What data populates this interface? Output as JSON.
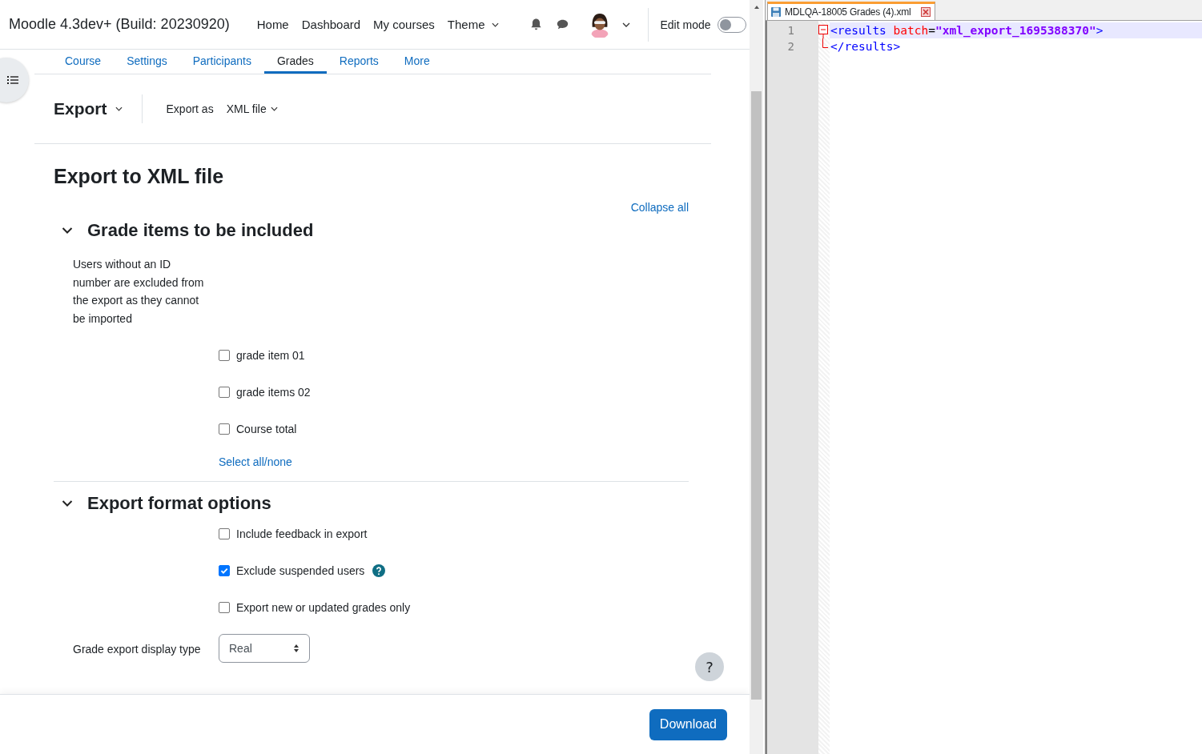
{
  "browser": {
    "site_name": "Moodle 4.3dev+ (Build: 20230920)",
    "nav_links": [
      {
        "label": "Home",
        "dropdown": false
      },
      {
        "label": "Dashboard",
        "dropdown": false
      },
      {
        "label": "My courses",
        "dropdown": false
      },
      {
        "label": "Theme",
        "dropdown": true
      }
    ],
    "edit_mode": {
      "label": "Edit mode",
      "on": false
    },
    "secondary_nav": [
      {
        "label": "Course",
        "selected": false
      },
      {
        "label": "Settings",
        "selected": false
      },
      {
        "label": "Participants",
        "selected": false
      },
      {
        "label": "Grades",
        "selected": true
      },
      {
        "label": "Reports",
        "selected": false
      },
      {
        "label": "More",
        "selected": false
      }
    ],
    "export_menu": "Export",
    "export_as": {
      "label": "Export as",
      "value": "XML file"
    },
    "page_title": "Export to XML file",
    "collapse_all": "Collapse all",
    "sections": [
      {
        "title": "Grade items to be included",
        "expanded": true,
        "description": "Users without an ID number are excluded from the export as they cannot be imported",
        "options": [
          {
            "label": "grade item 01",
            "checked": false,
            "help": false
          },
          {
            "label": "grade items 02",
            "checked": false,
            "help": false
          },
          {
            "label": "Course total",
            "checked": false,
            "help": false
          }
        ],
        "link": "Select all/none"
      },
      {
        "title": "Export format options",
        "expanded": true,
        "options": [
          {
            "label": "Include feedback in export",
            "checked": false,
            "help": false
          },
          {
            "label": "Exclude suspended users",
            "checked": true,
            "help": true
          },
          {
            "label": "Export new or updated grades only",
            "checked": false,
            "help": false
          }
        ],
        "select": {
          "label": "Grade export display type",
          "value": "Real"
        }
      }
    ],
    "help_button": "?",
    "download_button": "Download"
  },
  "editor": {
    "tab_title": "MDLQA-18005 Grades (4).xml",
    "lines": [
      {
        "number": "1",
        "kind": "fold_start",
        "tokens": [
          {
            "kind": "tag",
            "text": "<results"
          },
          {
            "kind": "attr",
            "text": "batch"
          },
          {
            "kind": "eq",
            "text": "="
          },
          {
            "kind": "value",
            "text": "\"xml_export_1695388370\""
          },
          {
            "kind": "tag",
            "text": ">"
          }
        ]
      },
      {
        "number": "2",
        "kind": "fold_end",
        "tokens": [
          {
            "kind": "tag",
            "text": "</results>"
          }
        ]
      }
    ]
  }
}
